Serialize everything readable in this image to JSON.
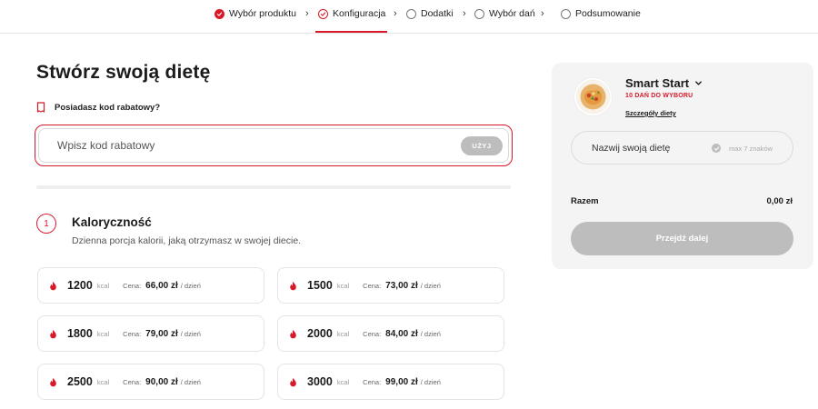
{
  "stepper": {
    "steps": [
      {
        "label": "Wybór produktu",
        "state": "done"
      },
      {
        "label": "Konfiguracja",
        "state": "active"
      },
      {
        "label": "Dodatki",
        "state": "todo"
      },
      {
        "label": "Wybór dań",
        "state": "todo"
      },
      {
        "label": "Podsumowanie",
        "state": "todo"
      }
    ],
    "separator": "›"
  },
  "main": {
    "title": "Stwórz swoją dietę",
    "promo_question": "Posiadasz kod rabatowy?",
    "coupon_placeholder": "Wpisz kod rabatowy",
    "coupon_button": "UŻYJ",
    "section": {
      "number": "1",
      "title": "Kaloryczność",
      "subtitle": "Dzienna porcja kalorii, jaką otrzymasz w swojej diecie."
    },
    "kcal_options": [
      {
        "kcal": "1200",
        "unit": "kcal",
        "price_label": "Cena:",
        "price": "66,00 zł",
        "per_day": "/ dzień"
      },
      {
        "kcal": "1500",
        "unit": "kcal",
        "price_label": "Cena:",
        "price": "73,00 zł",
        "per_day": "/ dzień"
      },
      {
        "kcal": "1800",
        "unit": "kcal",
        "price_label": "Cena:",
        "price": "79,00 zł",
        "per_day": "/ dzień"
      },
      {
        "kcal": "2000",
        "unit": "kcal",
        "price_label": "Cena:",
        "price": "84,00 zł",
        "per_day": "/ dzień"
      },
      {
        "kcal": "2500",
        "unit": "kcal",
        "price_label": "Cena:",
        "price": "90,00 zł",
        "per_day": "/ dzień"
      },
      {
        "kcal": "3000",
        "unit": "kcal",
        "price_label": "Cena:",
        "price": "99,00 zł",
        "per_day": "/ dzień"
      }
    ]
  },
  "summary": {
    "diet_name": "Smart Start",
    "diet_days": "10 DAŃ DO WYBORU",
    "diet_details_link": "Szczegóły diety",
    "name_placeholder": "Nazwij swoją dietę",
    "name_max_hint": "max 7 znaków",
    "total_label": "Razem",
    "total_value": "0,00 zł",
    "next_button": "Przejdź dalej"
  },
  "colors": {
    "accent": "#d7192a",
    "disabled": "#bdbdbd",
    "panel": "#f4f4f4"
  }
}
